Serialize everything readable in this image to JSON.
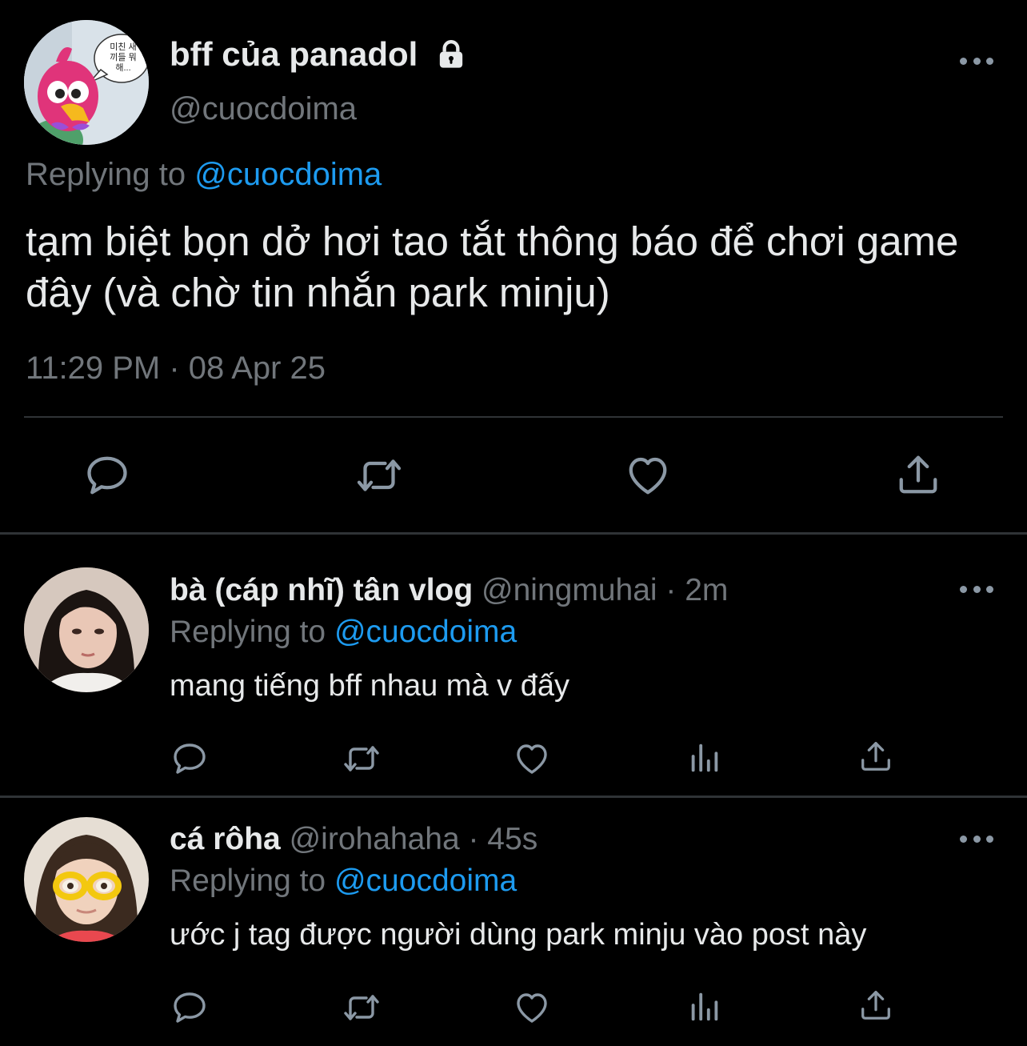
{
  "main_tweet": {
    "display_name": "bff của panadol",
    "handle": "@cuocdoima",
    "avatar_bubble_text": "미친 새끼들 뭐해...",
    "replying_label": "Replying to",
    "replying_handle": "@cuocdoima",
    "text": "tạm biệt bọn dở hơi tao tắt thông báo để chơi game đây (và chờ tin nhắn park minju)",
    "timestamp": "11:29 PM · 08 Apr 25"
  },
  "replies": [
    {
      "display_name": "bà (cáp nhĩ) tân vlog",
      "meta": "@ningmuhai · 2m",
      "replying_label": "Replying to",
      "replying_handle": "@cuocdoima",
      "text": "mang tiếng bff nhau mà v đấy"
    },
    {
      "display_name": "cá rôha",
      "meta": "@irohahaha · 45s",
      "replying_label": "Replying to",
      "replying_handle": "@cuocdoima",
      "text": "ước j tag được người dùng park minju vào post này"
    }
  ],
  "icons": {
    "action_bar": [
      "reply-icon",
      "retweet-icon",
      "like-icon",
      "share-icon"
    ],
    "reply_action_bar": [
      "reply-icon",
      "retweet-icon",
      "like-icon",
      "analytics-icon",
      "share-icon"
    ],
    "protected": "lock-icon",
    "overflow": "more-icon"
  },
  "colors": {
    "background": "#000000",
    "primary_text": "#e7e9ea",
    "secondary_text": "#71767b",
    "link": "#1d9bf0",
    "icon": "#8b98a5",
    "divider": "#2f3336"
  }
}
